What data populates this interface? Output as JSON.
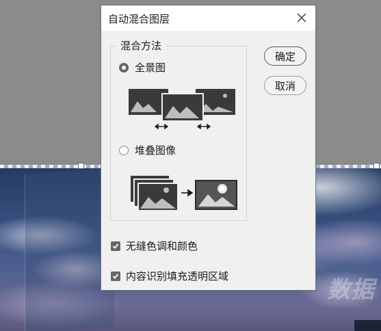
{
  "dialog": {
    "title": "自动混合图层",
    "group_title": "混合方法",
    "options": [
      {
        "label": "全景图",
        "selected": true
      },
      {
        "label": "堆叠图像",
        "selected": false
      }
    ],
    "checkboxes": [
      {
        "label": "无缝色调和颜色",
        "checked": true
      },
      {
        "label": "内容识别填充透明区域",
        "checked": true
      }
    ],
    "buttons": {
      "ok": "确定",
      "cancel": "取消"
    }
  },
  "background": {
    "watermark": "数据"
  },
  "colors": {
    "dialog_bg": "#f0f0f0",
    "accent_gray": "#666666",
    "canvas_gray": "#8b8b8b"
  }
}
